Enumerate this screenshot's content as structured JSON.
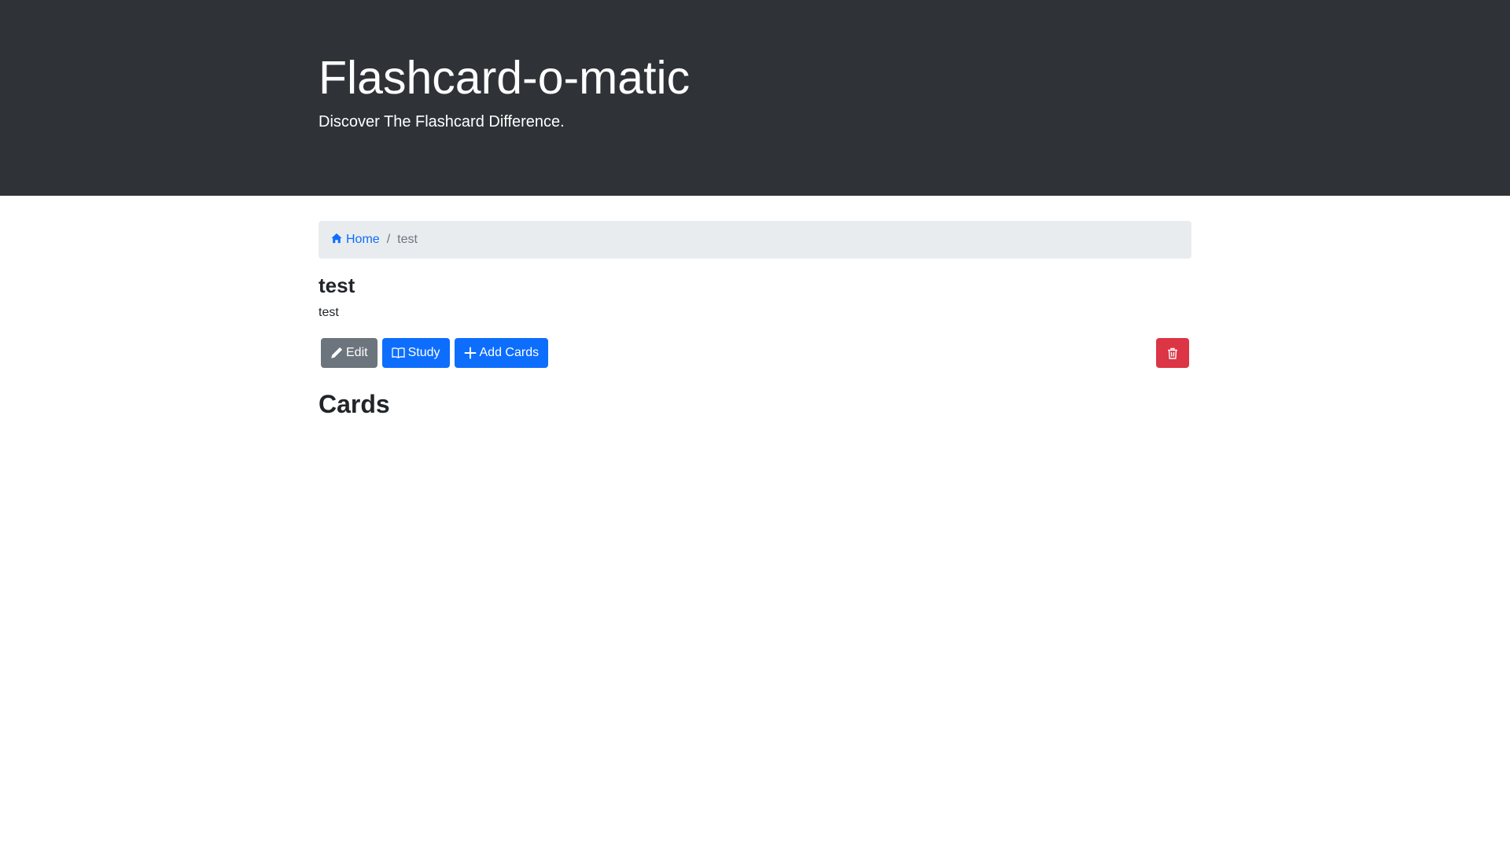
{
  "header": {
    "title": "Flashcard-o-matic",
    "subtitle": "Discover The Flashcard Difference."
  },
  "breadcrumb": {
    "home_label": "Home",
    "home_icon": "house-icon",
    "separator": "/",
    "current": "test"
  },
  "deck": {
    "name": "test",
    "description": "test"
  },
  "actions": {
    "edit_label": "Edit",
    "edit_icon": "pencil-icon",
    "study_label": "Study",
    "study_icon": "book-icon",
    "add_cards_label": "Add Cards",
    "add_cards_icon": "plus-icon",
    "delete_icon": "trash-icon"
  },
  "cards_section": {
    "heading": "Cards",
    "cards": []
  },
  "colors": {
    "header_bg": "#2f3338",
    "primary": "#0d6efd",
    "secondary": "#6c757d",
    "danger": "#dc3545",
    "breadcrumb_bg": "#e9ecef"
  }
}
